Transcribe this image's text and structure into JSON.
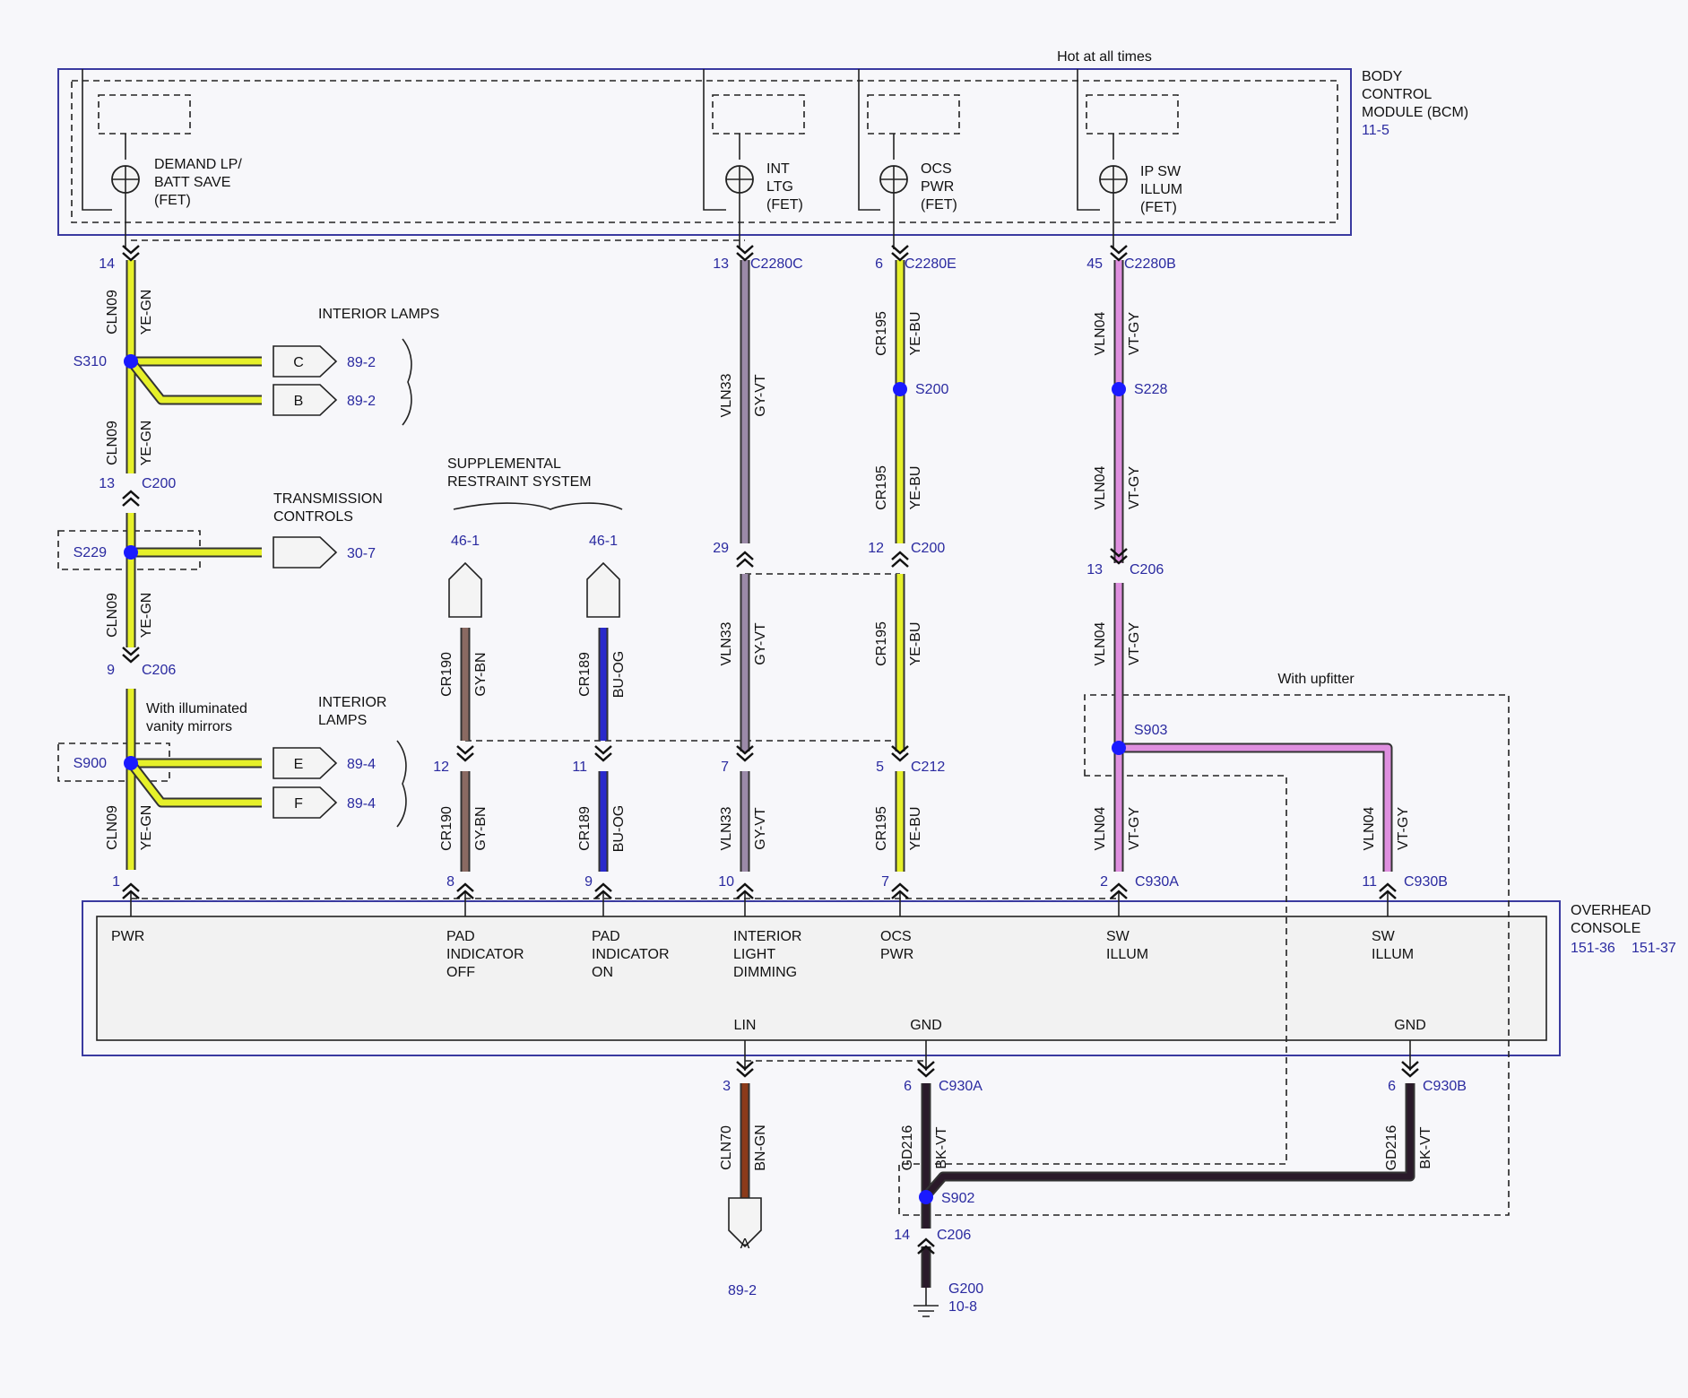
{
  "header_note": "Hot at all times",
  "modules": {
    "bcm": {
      "name_lines": [
        "BODY",
        "CONTROL",
        "MODULE (BCM)"
      ],
      "ref": "11-5"
    },
    "overhead": {
      "name_lines": [
        "OVERHEAD",
        "CONSOLE"
      ],
      "ref1": "151-36",
      "ref2": "151-37"
    }
  },
  "fets": [
    {
      "label_lines": [
        "DEMAND LP/",
        "BATT SAVE",
        "(FET)"
      ]
    },
    {
      "label_lines": [
        "INT",
        "LTG",
        "(FET)"
      ]
    },
    {
      "label_lines": [
        "OCS",
        "PWR",
        "(FET)"
      ]
    },
    {
      "label_lines": [
        "IP SW",
        "ILLUM",
        "(FET)"
      ]
    }
  ],
  "bcm_connectors": [
    {
      "pin": "14",
      "connector": ""
    },
    {
      "pin": "13",
      "connector": "C2280C"
    },
    {
      "pin": "6",
      "connector": "C2280E"
    },
    {
      "pin": "45",
      "connector": "C2280B"
    }
  ],
  "wire_segments": [
    {
      "circuit": "CLN09",
      "color_code": "YE-GN",
      "hex": "#e6f02a"
    },
    {
      "circuit": "CLN09",
      "color_code": "YE-GN",
      "hex": "#e6f02a"
    },
    {
      "circuit": "CLN09",
      "color_code": "YE-GN",
      "hex": "#e6f02a"
    },
    {
      "circuit": "CLN09",
      "color_code": "YE-GN",
      "hex": "#e6f02a"
    },
    {
      "circuit": "VLN33",
      "color_code": "GY-VT",
      "hex": "#9b8aa8"
    },
    {
      "circuit": "VLN33",
      "color_code": "GY-VT",
      "hex": "#9b8aa8"
    },
    {
      "circuit": "VLN33",
      "color_code": "GY-VT",
      "hex": "#9b8aa8"
    },
    {
      "circuit": "CR195",
      "color_code": "YE-BU",
      "hex": "#e6f02a"
    },
    {
      "circuit": "CR195",
      "color_code": "YE-BU",
      "hex": "#e6f02a"
    },
    {
      "circuit": "CR195",
      "color_code": "YE-BU",
      "hex": "#e6f02a"
    },
    {
      "circuit": "CR195",
      "color_code": "YE-BU",
      "hex": "#e6f02a"
    },
    {
      "circuit": "VLN04",
      "color_code": "VT-GY",
      "hex": "#df8fdf"
    },
    {
      "circuit": "VLN04",
      "color_code": "VT-GY",
      "hex": "#df8fdf"
    },
    {
      "circuit": "VLN04",
      "color_code": "VT-GY",
      "hex": "#df8fdf"
    },
    {
      "circuit": "VLN04",
      "color_code": "VT-GY",
      "hex": "#df8fdf"
    },
    {
      "circuit": "VLN04",
      "color_code": "VT-GY",
      "hex": "#df8fdf"
    },
    {
      "circuit": "CR190",
      "color_code": "GY-BN",
      "hex": "#8a6a62"
    },
    {
      "circuit": "CR190",
      "color_code": "GY-BN",
      "hex": "#8a6a62"
    },
    {
      "circuit": "CR189",
      "color_code": "BU-OG",
      "hex": "#2a2acc"
    },
    {
      "circuit": "CR189",
      "color_code": "BU-OG",
      "hex": "#2a2acc"
    },
    {
      "circuit": "CLN70",
      "color_code": "BN-GN",
      "hex": "#8b3a1a"
    },
    {
      "circuit": "GD216",
      "color_code": "BK-VT",
      "hex": "#2a1a2a"
    },
    {
      "circuit": "GD216",
      "color_code": "BK-VT",
      "hex": "#2a1a2a"
    }
  ],
  "splices": [
    {
      "id": "S310"
    },
    {
      "id": "S229"
    },
    {
      "id": "S900"
    },
    {
      "id": "S200"
    },
    {
      "id": "S228"
    },
    {
      "id": "S903"
    },
    {
      "id": "S902"
    }
  ],
  "inline_connectors": [
    {
      "pin": "13",
      "connector": "C200"
    },
    {
      "pin": "9",
      "connector": "C206"
    },
    {
      "pin": "29",
      "connector": ""
    },
    {
      "pin": "12",
      "connector": "C200"
    },
    {
      "pin": "13",
      "connector": "C206"
    },
    {
      "pin": "12",
      "connector": ""
    },
    {
      "pin": "11",
      "connector": ""
    },
    {
      "pin": "7",
      "connector": ""
    },
    {
      "pin": "5",
      "connector": "C212"
    },
    {
      "pin": "14",
      "connector": "C206"
    }
  ],
  "branch_groups": [
    {
      "label_lines": [
        "INTERIOR LAMPS"
      ]
    },
    {
      "label_lines": [
        "TRANSMISSION",
        "CONTROLS"
      ]
    },
    {
      "label_lines": [
        "INTERIOR",
        "LAMPS"
      ]
    },
    {
      "label_lines": [
        "SUPPLEMENTAL",
        "RESTRAINT SYSTEM"
      ]
    }
  ],
  "offpage_connectors": [
    {
      "letter": "C",
      "ref": "89-2"
    },
    {
      "letter": "B",
      "ref": "89-2"
    },
    {
      "letter": "",
      "ref": "30-7"
    },
    {
      "letter": "E",
      "ref": "89-4"
    },
    {
      "letter": "F",
      "ref": "89-4"
    },
    {
      "letter": "",
      "ref": "46-1"
    },
    {
      "letter": "",
      "ref": "46-1"
    },
    {
      "letter": "A",
      "ref": "89-2"
    }
  ],
  "options": {
    "vanity": [
      "With illuminated",
      "vanity mirrors"
    ],
    "upfitter": "With upfitter"
  },
  "overhead_pins": [
    {
      "pin": "1",
      "connector": "",
      "function_lines": [
        "PWR"
      ]
    },
    {
      "pin": "8",
      "connector": "",
      "function_lines": [
        "PAD",
        "INDICATOR",
        "OFF"
      ]
    },
    {
      "pin": "9",
      "connector": "",
      "function_lines": [
        "PAD",
        "INDICATOR",
        "ON"
      ]
    },
    {
      "pin": "10",
      "connector": "",
      "function_lines": [
        "INTERIOR",
        "LIGHT",
        "DIMMING"
      ]
    },
    {
      "pin": "7",
      "connector": "",
      "function_lines": [
        "OCS",
        "PWR"
      ]
    },
    {
      "pin": "2",
      "connector": "C930A",
      "function_lines": [
        "SW",
        "ILLUM"
      ]
    },
    {
      "pin": "11",
      "connector": "C930B",
      "function_lines": [
        "SW",
        "ILLUM"
      ]
    }
  ],
  "overhead_bottom_pins": [
    {
      "function": "LIN",
      "pin": "3",
      "connector": ""
    },
    {
      "function": "GND",
      "pin": "6",
      "connector": "C930A"
    },
    {
      "function": "GND",
      "pin": "6",
      "connector": "C930B"
    }
  ],
  "ground": {
    "id": "G200",
    "ref": "10-8"
  }
}
